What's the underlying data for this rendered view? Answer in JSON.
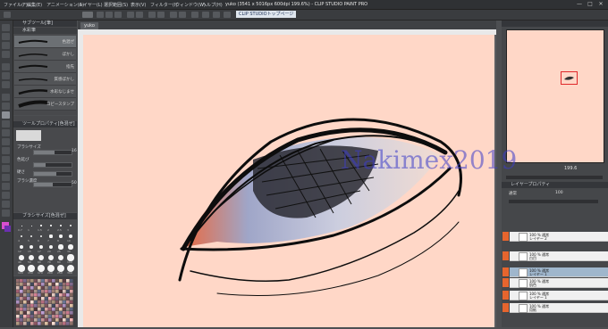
{
  "app": {
    "title": "yuko (3541 x 5016px 600dpi 199.6%) - CLIP STUDIO PAINT PRO",
    "menu": [
      "ファイル(F)",
      "編集(E)",
      "アニメーション(A)",
      "レイヤー(L)",
      "選択範囲(S)",
      "表示(V)",
      "フィルター(I)",
      "ウィンドウ(W)",
      "ヘルプ(H)"
    ],
    "window_buttons": [
      "—",
      "□",
      "✕"
    ]
  },
  "command_bar": {
    "active_tab": "CLIP STUDIOトップページ"
  },
  "document": {
    "tab_label": "yuko"
  },
  "subtool_panel": {
    "header": "サブツール[筆]",
    "group_label": "水彩筆",
    "brushes": [
      {
        "label": "色混ぜ",
        "selected": true
      },
      {
        "label": "ぼかし",
        "selected": false
      },
      {
        "label": "指先",
        "selected": false
      },
      {
        "label": "質感ぼかし",
        "selected": false
      },
      {
        "label": "水彩なじませ",
        "selected": false
      },
      {
        "label": "コピースタンプ",
        "selected": false
      }
    ]
  },
  "tool_property": {
    "header": "ツールプロパティ[色混ぜ]",
    "rows": [
      {
        "label": "ブラシサイズ",
        "value": "16",
        "level": 0.55
      },
      {
        "label": "色延び",
        "value": "",
        "level": 0.3
      },
      {
        "label": "硬さ",
        "value": "",
        "level": 0.6
      },
      {
        "label": "ブラシ濃度",
        "value": "50",
        "level": 0.5
      }
    ]
  },
  "brush_size_panel": {
    "header": "ブラシサイズ[色混ぜ]",
    "sizes": [
      "0.7",
      "1",
      "1.5",
      "2",
      "2.5",
      "3",
      "4",
      "5",
      "6",
      "7",
      "8",
      "10",
      "12",
      "15",
      "17",
      "20",
      "25",
      "30",
      "40",
      "50",
      "60",
      "70",
      "80",
      "100",
      "120",
      "150",
      "170",
      "200",
      "250",
      "300"
    ]
  },
  "navigator": {
    "zoom": "199.6"
  },
  "layer_panel": {
    "header": "レイヤープロパティ",
    "blend_mode": "通常",
    "opacity": "100",
    "layers": [
      {
        "name": "100 % 通常",
        "sub": "レイヤー 2",
        "selected": false
      },
      {
        "name": "100 % 通常",
        "sub": "白目",
        "selected": false
      },
      {
        "name": "100 % 通常",
        "sub": "レイヤー 1",
        "selected": true
      },
      {
        "name": "100 % 通常",
        "sub": "肌色",
        "selected": false
      },
      {
        "name": "100 % 通常",
        "sub": "レイヤー 1",
        "selected": false
      },
      {
        "name": "100 % 通常",
        "sub": "用紙",
        "selected": false
      }
    ]
  },
  "watermark": "Nakimex2019",
  "colors": {
    "paper": "#ffd7c7",
    "accent_orange": "#e6652e",
    "selection_blue": "#9fb6cc"
  }
}
